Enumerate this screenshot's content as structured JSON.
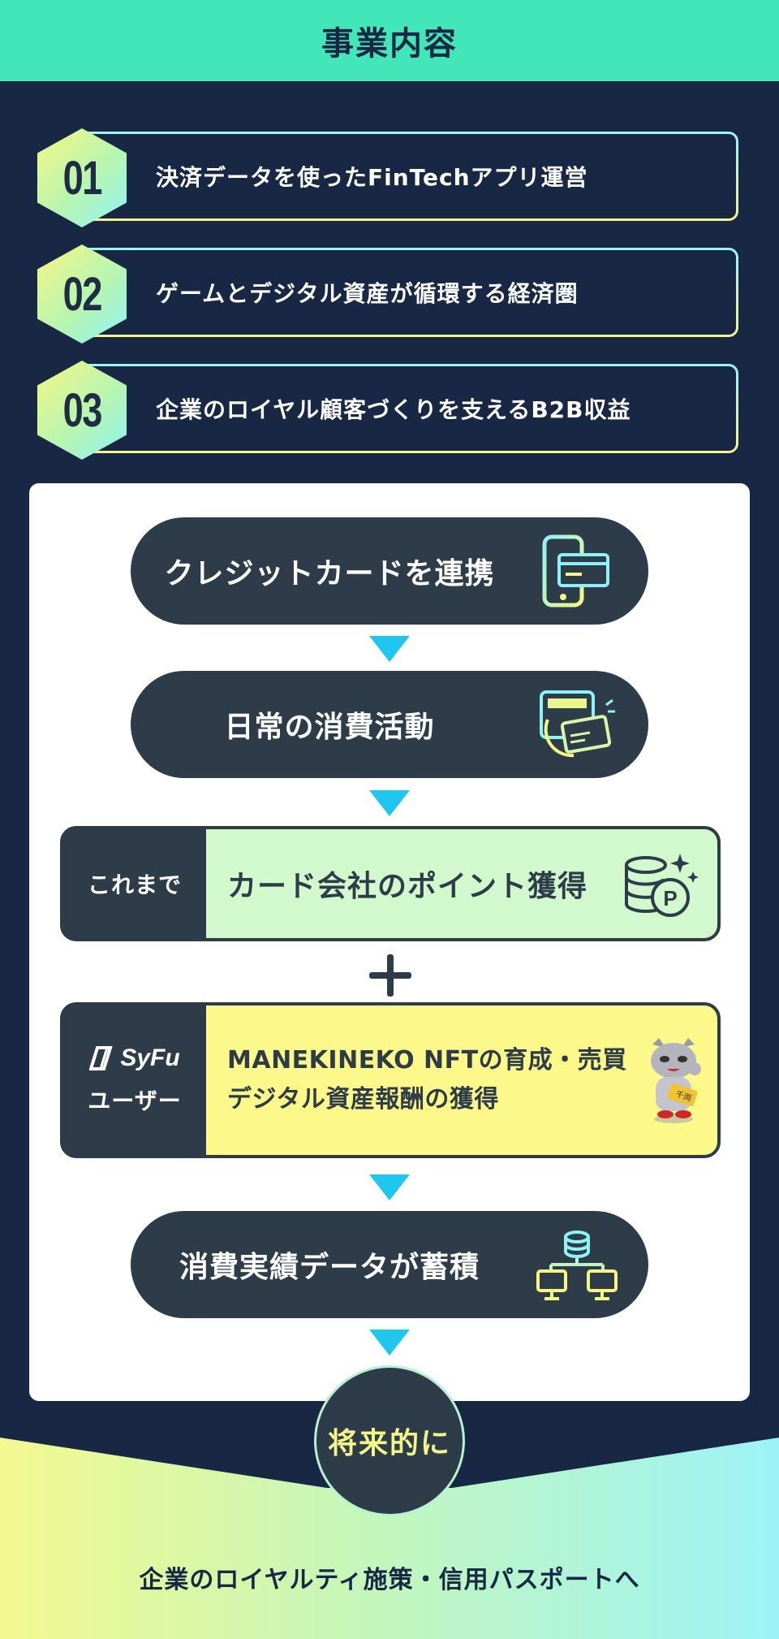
{
  "header": {
    "title": "事業内容"
  },
  "features": [
    {
      "num": "01",
      "text": "決済データを使ったFinTechアプリ運営"
    },
    {
      "num": "02",
      "text": "ゲームとデジタル資産が循環する経済圏"
    },
    {
      "num": "03",
      "text": "企業のロイヤル顧客づくりを支えるB2B収益"
    }
  ],
  "flow": {
    "step1": {
      "label": "クレジットカードを連携",
      "icon": "smartphone-card-icon"
    },
    "step2": {
      "label": "日常の消費活動",
      "icon": "payment-card-icon"
    },
    "points": {
      "side": "これまで",
      "label": "カード会社のポイント獲得",
      "icon": "coins-point-icon"
    },
    "syfu": {
      "logo": "SyFu",
      "side": "ユーザー",
      "line1": "MANEKINEKO NFTの育成・売買",
      "line2": "デジタル資産報酬の獲得",
      "icon": "manekineko-character"
    },
    "step5": {
      "label": "消費実績データが蓄積",
      "icon": "database-network-icon"
    }
  },
  "future": {
    "label": "将来的に"
  },
  "footer": {
    "text": "企業のロイヤルティ施策・信用パスポートへ"
  },
  "colors": {
    "navy": "#172744",
    "mint": "#42e6b8",
    "pill": "#2d3c48",
    "arrow": "#1fc7ef",
    "green": "#d2f8cd",
    "yellow": "#fdf88a"
  }
}
